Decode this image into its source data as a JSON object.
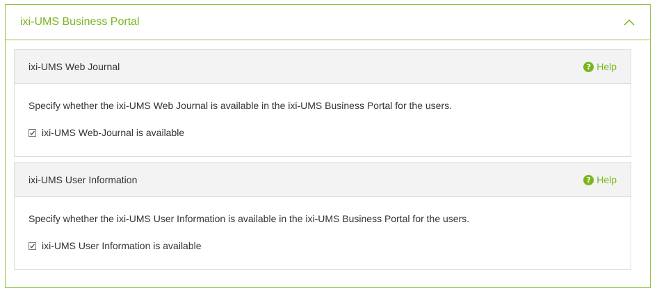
{
  "panel": {
    "title": "ixi-UMS Business Portal",
    "collapse_icon": "chevron-up-icon"
  },
  "sections": [
    {
      "title": "ixi-UMS Web Journal",
      "help_label": "Help",
      "description": "Specify whether the ixi-UMS Web Journal is available in the ixi-UMS Business Portal for the users.",
      "checkbox_label": "ixi-UMS Web-Journal is available",
      "checked": true
    },
    {
      "title": "ixi-UMS User Information",
      "help_label": "Help",
      "description": "Specify whether the ixi-UMS User Information is available in the ixi-UMS Business Portal for the users.",
      "checkbox_label": "ixi-UMS User Information is available",
      "checked": true
    }
  ],
  "colors": {
    "accent": "#7ab51d",
    "border_accent": "#8cc63f",
    "section_header_bg": "#f3f3f3"
  }
}
